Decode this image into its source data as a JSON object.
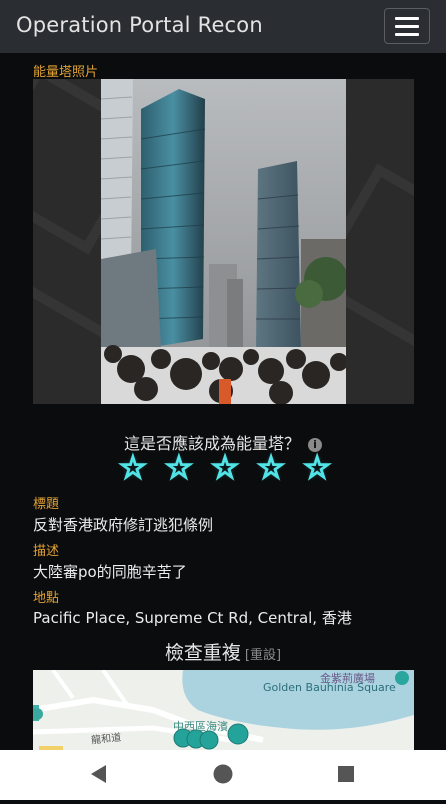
{
  "header": {
    "title": "Operation Portal Recon",
    "menu_icon": "hamburger-icon"
  },
  "photo_section": {
    "label": "能量塔照片"
  },
  "rating": {
    "question": "這是否應該成為能量塔？",
    "info_icon": "info-icon",
    "stars": 5,
    "star_glyph": "☆",
    "star_color": "#52e3e6"
  },
  "details": {
    "title_label": "標題",
    "title_value": "反對香港政府修訂逃犯條例",
    "description_label": "描述",
    "description_value": "大陸審po的同胞辛苦了",
    "location_label": "地點",
    "location_value": "Pacific Place, Supreme Ct Rd, Central, 香港"
  },
  "duplicates": {
    "title": "檢查重複",
    "reset_label": "[重設]"
  },
  "map": {
    "label_cn": "金紫荊廣場",
    "label_en": "Golden Bauhinia Square",
    "district_label": "中西區海濱",
    "road_label": "龍和道"
  },
  "android_nav": {
    "back_icon": "back-triangle-icon",
    "home_icon": "home-circle-icon",
    "recents_icon": "recents-square-icon"
  },
  "colors": {
    "accent_gold": "#e1a235",
    "header_bg": "#2a2d31",
    "background": "#0b0c0d"
  }
}
